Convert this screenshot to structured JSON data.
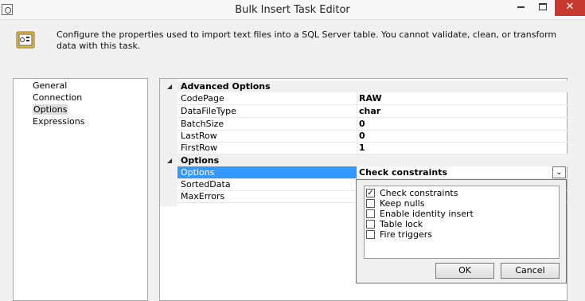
{
  "window": {
    "title": "Bulk Insert Task Editor"
  },
  "banner": {
    "icon": "database-config-icon",
    "text": "Configure the properties used to import text files into a SQL Server table. You cannot validate, clean, or transform data with this task."
  },
  "nav": {
    "items": [
      {
        "label": "General",
        "selected": false
      },
      {
        "label": "Connection",
        "selected": false
      },
      {
        "label": "Options",
        "selected": true
      },
      {
        "label": "Expressions",
        "selected": false
      }
    ]
  },
  "grid": {
    "categories": [
      {
        "label": "Advanced Options",
        "properties": [
          {
            "name": "CodePage",
            "value": "RAW"
          },
          {
            "name": "DataFileType",
            "value": "char"
          },
          {
            "name": "BatchSize",
            "value": "0"
          },
          {
            "name": "LastRow",
            "value": "0"
          },
          {
            "name": "FirstRow",
            "value": "1"
          }
        ]
      },
      {
        "label": "Options",
        "properties": [
          {
            "name": "Options",
            "value": "Check constraints",
            "selected": true
          },
          {
            "name": "SortedData",
            "value": ""
          },
          {
            "name": "MaxErrors",
            "value": ""
          }
        ]
      }
    ],
    "expand_glyph": "◢"
  },
  "dropdown": {
    "checkbox_items": [
      {
        "label": "Check constraints",
        "checked": true
      },
      {
        "label": "Keep nulls",
        "checked": false
      },
      {
        "label": "Enable identity insert",
        "checked": false
      },
      {
        "label": "Table lock",
        "checked": false
      },
      {
        "label": "Fire triggers",
        "checked": false
      }
    ],
    "ok_label": "OK",
    "cancel_label": "Cancel",
    "toggle_glyph": "⌄"
  },
  "colors": {
    "selection": "#3399ff",
    "close_button": "#c7392f"
  }
}
